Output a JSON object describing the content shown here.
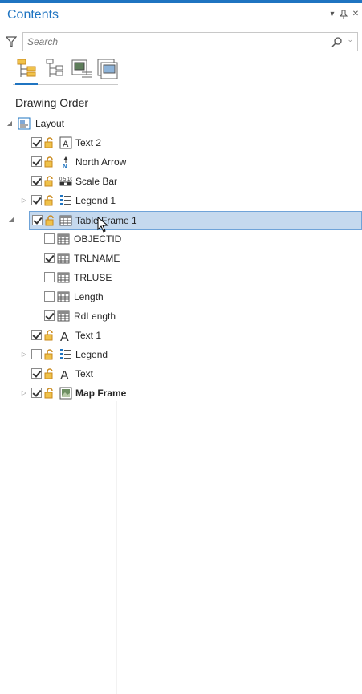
{
  "panel": {
    "title": "Contents",
    "search_placeholder": "Search",
    "section_title": "Drawing Order"
  },
  "tree": {
    "root_label": "Layout",
    "items": [
      {
        "label": "Text 2",
        "checked": true,
        "icon": "text-icon"
      },
      {
        "label": "North Arrow",
        "checked": true,
        "icon": "north-arrow-icon"
      },
      {
        "label": "Scale Bar",
        "checked": true,
        "icon": "scale-bar-icon"
      },
      {
        "label": "Legend 1",
        "checked": true,
        "icon": "legend-icon",
        "expandable": true
      },
      {
        "label": "Table Frame 1",
        "checked": true,
        "icon": "table-icon",
        "expanded": true,
        "selected": true,
        "children": [
          {
            "label": "OBJECTID",
            "checked": false
          },
          {
            "label": "TRLNAME",
            "checked": true
          },
          {
            "label": "TRLUSE",
            "checked": false
          },
          {
            "label": "Length",
            "checked": false
          },
          {
            "label": "RdLength",
            "checked": true
          }
        ]
      },
      {
        "label": "Text 1",
        "checked": true,
        "icon": "text-icon"
      },
      {
        "label": "Legend",
        "checked": false,
        "icon": "legend-icon",
        "expandable": true
      },
      {
        "label": "Text",
        "checked": true,
        "icon": "text-icon"
      },
      {
        "label": "Map Frame",
        "checked": true,
        "icon": "map-frame-icon",
        "expandable": true,
        "bold": true
      }
    ]
  },
  "colors": {
    "accent": "#1f74c1",
    "selection": "#c5d9ee",
    "lock": "#c98a1e"
  }
}
